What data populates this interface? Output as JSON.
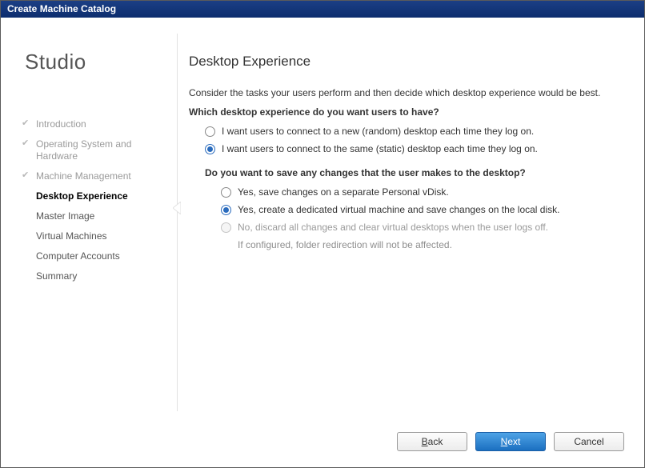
{
  "window": {
    "title": "Create Machine Catalog"
  },
  "brand": "Studio",
  "nav": {
    "items": [
      {
        "label": "Introduction",
        "state": "done"
      },
      {
        "label": "Operating System and Hardware",
        "state": "done"
      },
      {
        "label": "Machine Management",
        "state": "done"
      },
      {
        "label": "Desktop Experience",
        "state": "current"
      },
      {
        "label": "Master Image",
        "state": "pending"
      },
      {
        "label": "Virtual Machines",
        "state": "pending"
      },
      {
        "label": "Computer Accounts",
        "state": "pending"
      },
      {
        "label": "Summary",
        "state": "pending"
      }
    ]
  },
  "page": {
    "heading": "Desktop Experience",
    "intro": "Consider the tasks your users perform and then decide which desktop experience would be best.",
    "q1": "Which desktop experience do you want users to have?",
    "opt_random": "I want users to connect to a new (random) desktop each time they log on.",
    "opt_static": "I want users to connect to the same (static) desktop each time they log on.",
    "q2": "Do you want to save any changes that the user makes to the desktop?",
    "opt_pvd": "Yes, save changes on a separate Personal vDisk.",
    "opt_dedicated": "Yes, create a dedicated virtual machine and save changes on the local disk.",
    "opt_discard": "No, discard all changes and clear virtual desktops when the user logs off.",
    "discard_hint": "If configured, folder redirection will not be affected.",
    "selection": {
      "experience": "static",
      "save": "dedicated"
    }
  },
  "footer": {
    "back": "Back",
    "next": "Next",
    "cancel": "Cancel"
  }
}
